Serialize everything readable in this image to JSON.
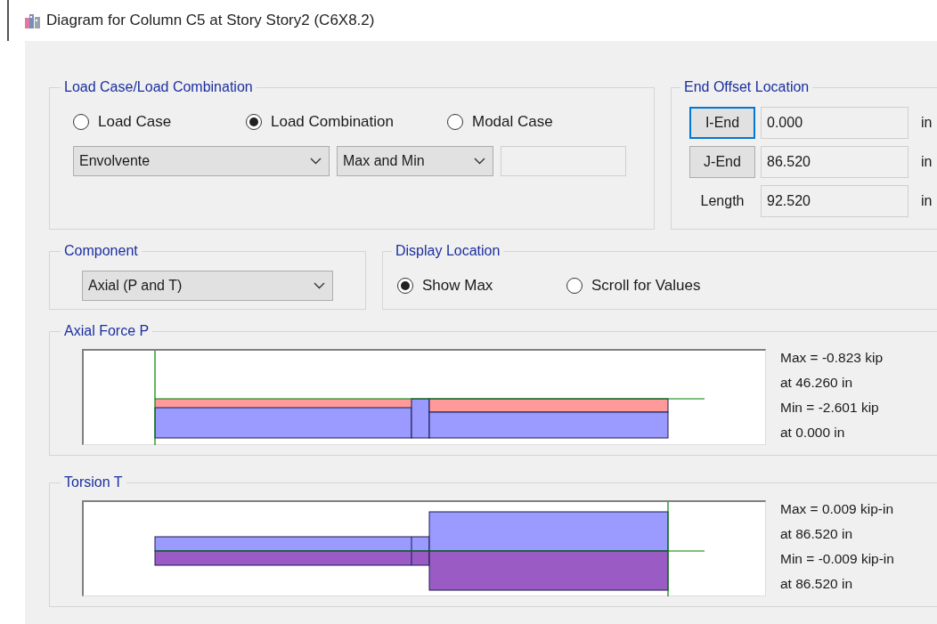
{
  "window": {
    "title": "Diagram for Column C5 at Story Story2 (C6X8.2)"
  },
  "load_case_group": {
    "legend": "Load Case/Load Combination",
    "options": [
      {
        "label": "Load Case",
        "selected": false
      },
      {
        "label": "Load Combination",
        "selected": true
      },
      {
        "label": "Modal Case",
        "selected": false
      }
    ],
    "combination_dropdown": {
      "value": "Envolvente"
    },
    "type_dropdown": {
      "value": "Max and Min"
    }
  },
  "end_offset": {
    "legend": "End Offset Location",
    "rows": [
      {
        "kind": "button",
        "label": "I-End",
        "focused": true,
        "value": "0.000",
        "unit": "in"
      },
      {
        "kind": "button",
        "label": "J-End",
        "focused": false,
        "value": "86.520",
        "unit": "in"
      },
      {
        "kind": "label",
        "label": "Length",
        "value": "92.520",
        "unit": "in"
      }
    ]
  },
  "component": {
    "legend": "Component",
    "dropdown": {
      "value": "Axial (P and T)"
    }
  },
  "display_location": {
    "legend": "Display Location",
    "options": [
      {
        "label": "Show Max",
        "selected": true
      },
      {
        "label": "Scroll for Values",
        "selected": false
      }
    ]
  },
  "diagrams": [
    {
      "kind": "axial",
      "title": "Axial Force P",
      "lines": [
        "Max = -0.823 kip",
        "at 46.260 in",
        "Min = -2.601 kip",
        "at 0.000 in"
      ]
    },
    {
      "kind": "torsion",
      "title": "Torsion T",
      "lines": [
        "Max = 0.009 kip-in",
        "at 86.520 in",
        "Min = -0.009 kip-in",
        "at 86.520 in"
      ]
    }
  ]
}
